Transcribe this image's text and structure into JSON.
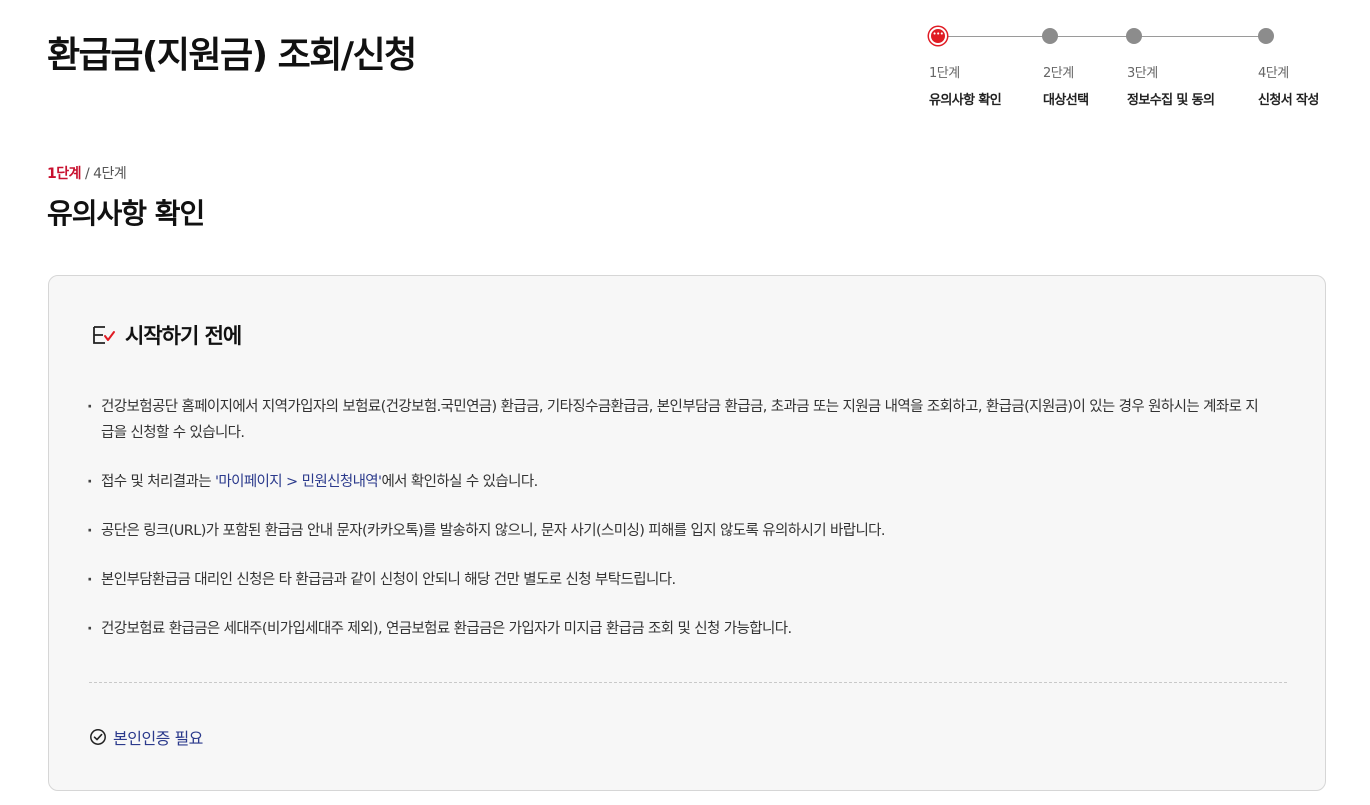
{
  "page": {
    "title": "환급금(지원금) 조회/신청"
  },
  "stepper": {
    "steps": [
      {
        "number": "1단계",
        "label": "유의사항 확인",
        "active": true
      },
      {
        "number": "2단계",
        "label": "대상선택",
        "active": false
      },
      {
        "number": "3단계",
        "label": "정보수집 및 동의",
        "active": false
      },
      {
        "number": "4단계",
        "label": "신청서 작성",
        "active": false
      }
    ],
    "active_color": "#e01c24",
    "inactive_color": "#8c8c8c"
  },
  "progress": {
    "current": "1단계",
    "separator": "/",
    "total": "4단계"
  },
  "section": {
    "title": "유의사항 확인"
  },
  "notice_box": {
    "heading": "시작하기 전에",
    "heading_icon": "checklist-icon",
    "items": [
      {
        "text": "건강보험공단 홈페이지에서 지역가입자의 보험료(건강보험.국민연금) 환급금, 기타징수금환급금, 본인부담금 환급금, 초과금 또는 지원금 내역을 조회하고, 환급금(지원금)이 있는 경우 원하시는 계좌로 지급을 신청할 수 있습니다."
      },
      {
        "prefix": "접수 및 처리결과는 ",
        "link": "'마이페이지 > 민원신청내역'",
        "suffix": "에서 확인하실 수 있습니다."
      },
      {
        "text": "공단은 링크(URL)가 포함된 환급금 안내 문자(카카오톡)를 발송하지 않으니, 문자 사기(스미싱) 피해를 입지 않도록 유의하시기 바랍니다."
      },
      {
        "text": "본인부담환급금 대리인 신청은 타 환급금과 같이 신청이 안되니 해당 건만 별도로 신청 부탁드립니다."
      },
      {
        "text": "건강보험료 환급금은 세대주(비가입세대주 제외), 연금보험료 환급금은 가입자가 미지급 환급금 조회 및 신청 가능합니다."
      }
    ],
    "auth_required": "본인인증 필요",
    "auth_icon": "check-circle-icon"
  },
  "colors": {
    "accent_red": "#c8102e",
    "link_blue": "#2b3a8c"
  }
}
